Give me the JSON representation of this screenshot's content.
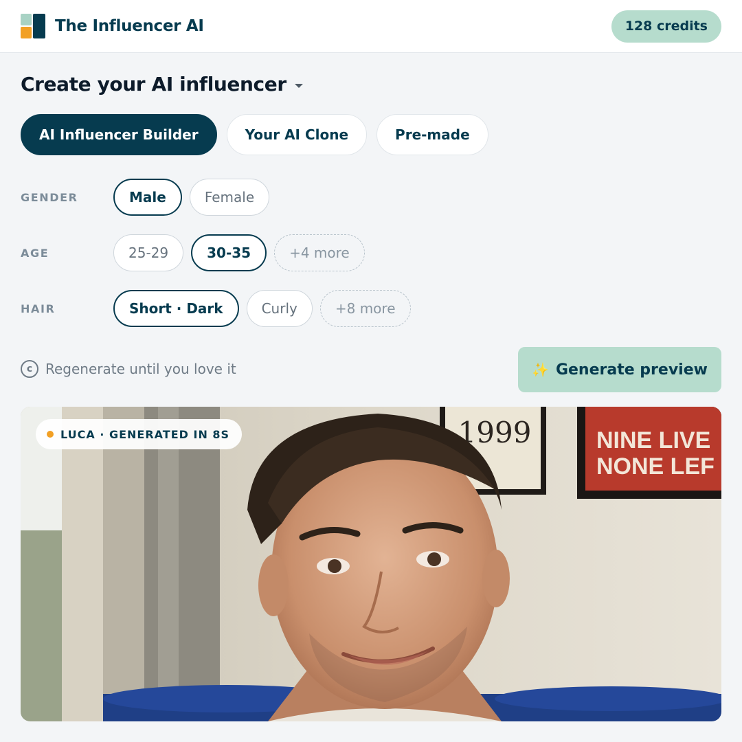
{
  "header": {
    "brand_name": "The Influencer AI",
    "credits": "128 credits"
  },
  "page": {
    "title": "Create your AI influencer"
  },
  "modes": [
    {
      "label": "AI Influencer Builder",
      "active": true
    },
    {
      "label": "Your AI Clone",
      "active": false
    },
    {
      "label": "Pre-made",
      "active": false
    }
  ],
  "filters": {
    "gender": {
      "label": "GENDER",
      "options": [
        "Male",
        "Female"
      ],
      "selected": "Male"
    },
    "age": {
      "label": "AGE",
      "options": [
        "25-29",
        "30-35"
      ],
      "more": "+4 more",
      "selected": "30-35"
    },
    "hair": {
      "label": "HAIR",
      "options": [
        "Short · Dark",
        "Curly"
      ],
      "more": "+8 more",
      "selected": "Short · Dark"
    }
  },
  "regenerate": {
    "text": "Regenerate until you love it",
    "icon": "c"
  },
  "generate_button": {
    "label": "Generate preview",
    "icon": "sparkle-icon"
  },
  "preview": {
    "tag": "LUCA · GENERATED IN 8S",
    "poster_1": "1999",
    "poster_2_line_1": "NINE LIVE",
    "poster_2_line_2": "NONE LEF"
  },
  "colors": {
    "brand_dark": "#063b4f",
    "brand_mint": "#b6dccd",
    "accent_orange": "#f2a024",
    "background": "#f3f5f7"
  }
}
